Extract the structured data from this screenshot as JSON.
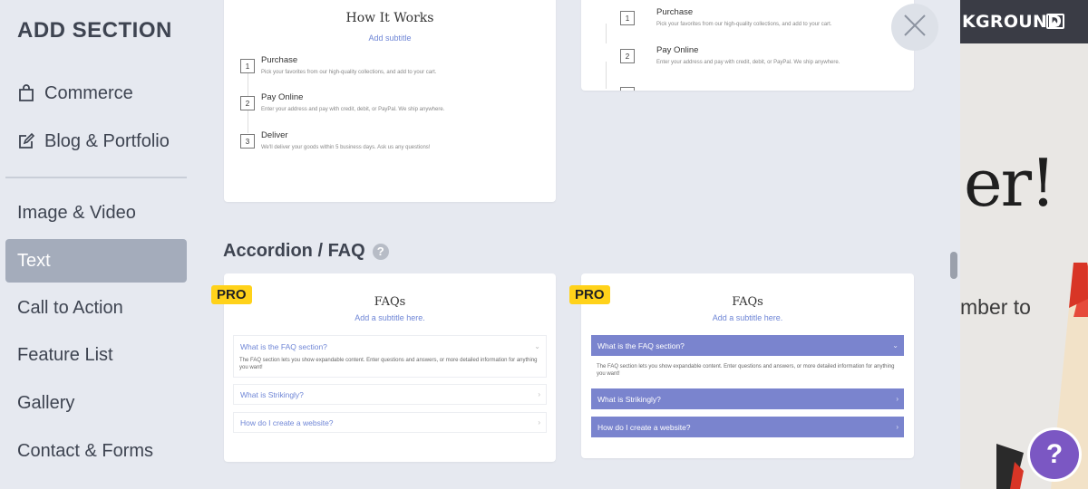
{
  "sidebar": {
    "title": "ADD SECTION",
    "items": [
      {
        "label": "Commerce",
        "icon": "shopping-bag-icon"
      },
      {
        "label": "Blog & Portfolio",
        "icon": "edit-icon"
      },
      {
        "label": "Image & Video"
      },
      {
        "label": "Text",
        "active": true
      },
      {
        "label": "Call to Action"
      },
      {
        "label": "Feature List"
      },
      {
        "label": "Gallery"
      },
      {
        "label": "Contact & Forms"
      }
    ]
  },
  "templates": {
    "how_it_works": {
      "title": "How It Works",
      "subtitle": "Add subtitle",
      "steps": [
        {
          "num": "1",
          "title": "Purchase",
          "desc": "Pick your favorites from our high-quality collections, and add to your cart."
        },
        {
          "num": "2",
          "title": "Pay Online",
          "desc": "Enter your address and pay with credit, debit, or PayPal. We ship anywhere."
        },
        {
          "num": "3",
          "title": "Deliver",
          "desc": "We'll deliver your goods within 5 business days. Ask us any questions!"
        }
      ]
    },
    "how_it_works_2": {
      "steps": [
        {
          "num": "1",
          "title": "Purchase",
          "desc": "Pick your favorites from our high-quality collections, and add to your cart."
        },
        {
          "num": "2",
          "title": "Pay Online",
          "desc": "Enter your address and pay with credit, debit, or PayPal. We ship anywhere."
        }
      ]
    }
  },
  "accordion_section": {
    "title": "Accordion / FAQ",
    "help_icon": "question-icon"
  },
  "faq_cards": [
    {
      "badge": "PRO",
      "title": "FAQs",
      "subtitle": "Add a subtitle here.",
      "q1": "What is the FAQ section?",
      "a1": "The FAQ section lets you show expandable content. Enter questions and answers, or more detailed information for anything you want!",
      "q2": "What is Strikingly?",
      "q3": "How do I create a website?"
    },
    {
      "badge": "PRO",
      "title": "FAQs",
      "subtitle": "Add a subtitle here.",
      "q1": "What is the FAQ section?",
      "a1": "The FAQ section lets you show expandable content. Enter questions and answers, or more detailed information for anything you want!",
      "q2": "What is Strikingly?",
      "q3": "How do I create a website?"
    }
  ],
  "background_site": {
    "topbar_text": "KGROUND",
    "heading": "er!",
    "body_text": "mber to"
  },
  "help_button": "?",
  "colors": {
    "accent": "#7a84ce",
    "pro_badge": "#ffd21a",
    "help_button": "#7b57c3",
    "active_nav": "#a4acbb"
  }
}
